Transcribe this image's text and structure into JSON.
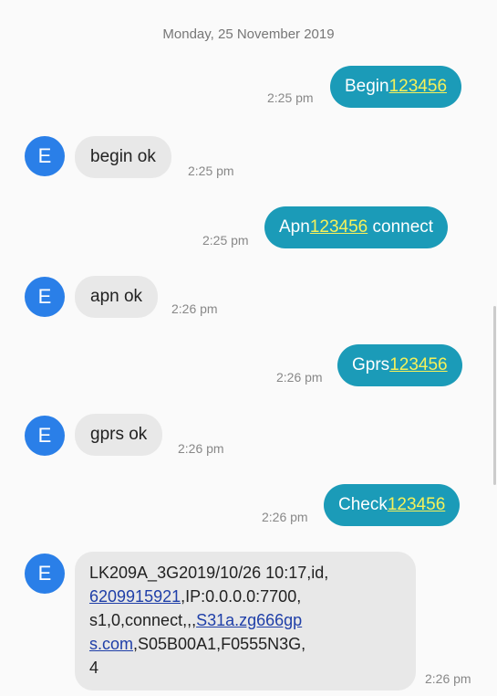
{
  "date_separator": "Monday, 25 November 2019",
  "messages": [
    {
      "prefix": "Begin",
      "code": "123456",
      "suffix": "",
      "time": "2:25 pm"
    },
    {
      "avatar": "E",
      "text": "begin ok",
      "time": "2:25 pm"
    },
    {
      "prefix": "Apn",
      "code": "123456",
      "suffix": " connect",
      "time": "2:25 pm"
    },
    {
      "avatar": "E",
      "text": "apn ok",
      "time": "2:26 pm"
    },
    {
      "prefix": "Gprs",
      "code": "123456",
      "suffix": "",
      "time": "2:26 pm"
    },
    {
      "avatar": "E",
      "text": "gprs ok",
      "time": "2:26 pm"
    },
    {
      "prefix": "Check",
      "code": "123456",
      "suffix": "",
      "time": "2:26 pm"
    },
    {
      "avatar": "E",
      "line1": "LK209A_3G2019/10/26 10:17,id,",
      "phone": "6209915921",
      "after_phone": ",IP:0.0.0.0:7700,",
      "line3_pre": "s1,0,connect,,,",
      "link_part1": "S31a.zg666gp",
      "link_part2": "s.com",
      "after_link": ",S05B00A1,F0555N3G,",
      "line5": "4",
      "time": "2:26 pm"
    }
  ]
}
